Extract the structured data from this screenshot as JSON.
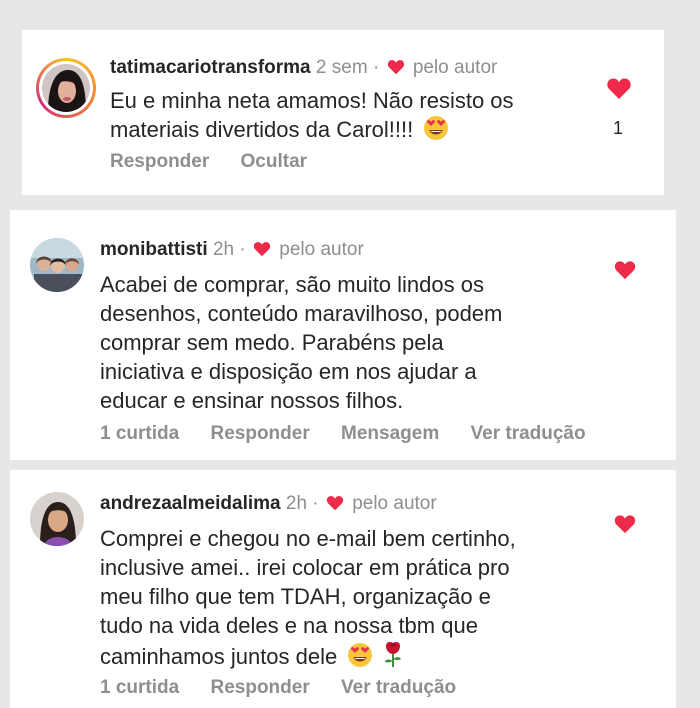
{
  "comments": [
    {
      "username": "tatimacariotransforma",
      "time": "2 sem",
      "separator": "·",
      "liked_by_author": "pelo autor",
      "text_line1": "Eu e minha neta amamos! Não resisto os",
      "text_line2": "materiais divertidos da Carol!!!!",
      "emoji": "heart-eyes-emoji",
      "like_count": "1",
      "actions": [
        "Responder",
        "Ocultar"
      ]
    },
    {
      "username": "monibattisti",
      "time": "2h",
      "separator": "·",
      "liked_by_author": "pelo autor",
      "text_lines": [
        "Acabei de comprar, são muito lindos os",
        "desenhos, conteúdo maravilhoso, podem",
        "comprar sem medo. Parabéns pela",
        "iniciativa e disposição em nos ajudar a",
        "educar e ensinar nossos filhos."
      ],
      "actions": [
        "1 curtida",
        "Responder",
        "Mensagem",
        "Ver tradução"
      ]
    },
    {
      "username": "andrezaalmeidalima",
      "time": "2h",
      "separator": "·",
      "liked_by_author": "pelo autor",
      "text_lines": [
        "Comprei e chegou no e-mail bem certinho,",
        "inclusive amei.. irei colocar em prática pro",
        "meu filho que tem TDAH, organização e",
        "tudo na vida deles e na nossa tbm que",
        "caminhamos juntos dele"
      ],
      "emojis": [
        "heart-eyes-emoji",
        "rose-emoji"
      ],
      "actions": [
        "1 curtida",
        "Responder",
        "Ver tradução"
      ]
    }
  ],
  "colors": {
    "like_red": "#ed2a4a",
    "muted_gray": "#8e8e8e",
    "text": "#262626",
    "background": "#e6e7e9"
  }
}
